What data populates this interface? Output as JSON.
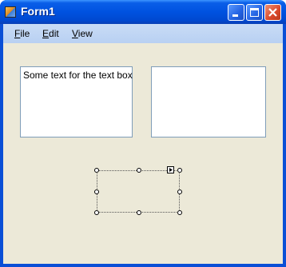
{
  "window": {
    "title": "Form1",
    "icons": {
      "app": "form-app-icon",
      "minimize": "minimize-icon",
      "maximize": "maximize-icon",
      "close": "close-icon"
    }
  },
  "menu": {
    "items": [
      {
        "label": "File",
        "mnemonic": "F"
      },
      {
        "label": "Edit",
        "mnemonic": "E"
      },
      {
        "label": "View",
        "mnemonic": "V"
      }
    ]
  },
  "textbox1": {
    "value": "Some text for the text box"
  },
  "textbox2": {
    "value": ""
  },
  "selection": {
    "smart_tag_icon": "smart-tag-arrow-icon"
  },
  "colors": {
    "titlebar": "#0054e3",
    "client": "#ece9d8",
    "menubar": "#c1d4f1",
    "close_button": "#d9482a"
  }
}
